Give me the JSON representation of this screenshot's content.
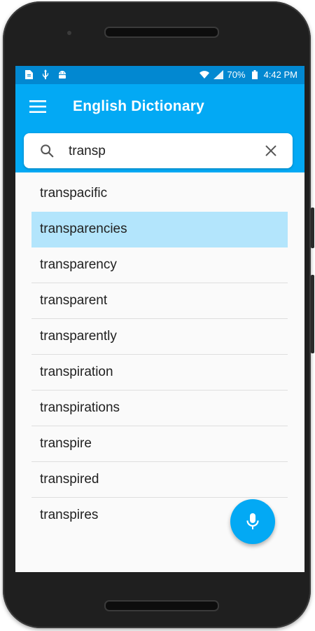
{
  "status_bar": {
    "battery": "70%",
    "time": "4:42 PM",
    "left_icons": [
      "file-icon",
      "usb-icon",
      "android-icon"
    ],
    "right_icons": [
      "wifi-icon",
      "signal-icon",
      "battery-icon"
    ]
  },
  "app_bar": {
    "title": "English Dictionary",
    "menu_icon": "hamburger-menu-icon"
  },
  "search": {
    "value": "transp",
    "search_icon": "search-icon",
    "clear_icon": "close-icon"
  },
  "results": [
    "transpacific",
    "transparencies",
    "transparency",
    "transparent",
    "transparently",
    "transpiration",
    "transpirations",
    "transpire",
    "transpired",
    "transpires"
  ],
  "selected_index": 1,
  "fab": {
    "icon": "microphone-icon"
  },
  "colors": {
    "primary": "#03a9f4",
    "primary_dark": "#0288d1",
    "selected_row": "#b3e5fc"
  }
}
